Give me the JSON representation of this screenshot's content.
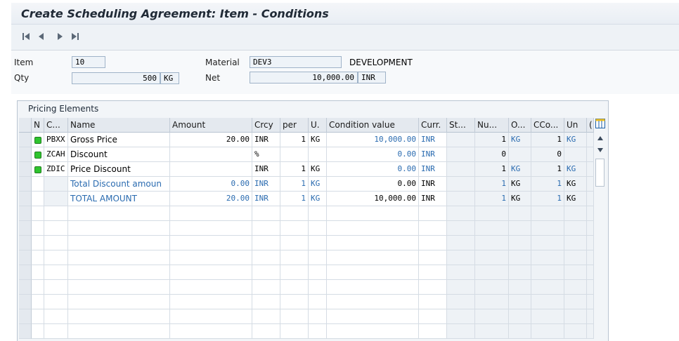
{
  "window": {
    "title": "Create Scheduling Agreement: Item - Conditions"
  },
  "toolbar": {
    "icons": [
      "first-page-icon",
      "previous-page-icon",
      "next-page-icon",
      "last-page-icon"
    ]
  },
  "header": {
    "item_label": "Item",
    "item_value": "10",
    "qty_label": "Qty",
    "qty_value": "500",
    "qty_unit": "KG",
    "material_label": "Material",
    "material_value": "DEV3",
    "material_desc": "DEVELOPMENT",
    "net_label": "Net",
    "net_value": "10,000.00",
    "net_currency": "INR"
  },
  "pricing": {
    "title": "Pricing Elements",
    "columns": [
      "N",
      "C...",
      "Name",
      "Amount",
      "Crcy",
      "per",
      "U.",
      "Condition value",
      "Curr.",
      "St...",
      "Nu...",
      "O...",
      "CCo...",
      "Un",
      "("
    ],
    "rows": [
      {
        "status": true,
        "ctype": "PBXX",
        "name": "Gross Price",
        "amount": "20.00",
        "crcy": "INR",
        "per": "1",
        "uom": "KG",
        "cond_value": "10,000.00",
        "curr": "INR",
        "st": "",
        "nu": "1",
        "o": "KG",
        "cco": "1",
        "un": "KG"
      },
      {
        "status": true,
        "ctype": "ZCAH",
        "name": "Discount",
        "amount": "",
        "crcy": "%",
        "per": "",
        "uom": "",
        "cond_value": "0.00",
        "curr": "INR",
        "st": "",
        "nu": "0",
        "o": "",
        "cco": "0",
        "un": ""
      },
      {
        "status": true,
        "ctype": "ZDIC",
        "name": "Price Discount",
        "amount": "",
        "crcy": "INR",
        "per": "1",
        "uom": "KG",
        "cond_value": "0.00",
        "curr": "INR",
        "st": "",
        "nu": "1",
        "o": "KG",
        "cco": "1",
        "un": "KG"
      },
      {
        "status": false,
        "ctype": "",
        "name": "Total Discount amoun",
        "amount": "0.00",
        "crcy": "INR",
        "per": "1",
        "uom": "KG",
        "cond_value": "0.00",
        "curr": "INR",
        "st": "",
        "nu": "1",
        "o": "KG",
        "cco": "1",
        "un": "KG"
      },
      {
        "status": false,
        "ctype": "",
        "name": "TOTAL AMOUNT",
        "amount": "20.00",
        "crcy": "INR",
        "per": "1",
        "uom": "KG",
        "cond_value": "10,000.00",
        "curr": "INR",
        "st": "",
        "nu": "1",
        "o": "KG",
        "cco": "1",
        "un": "KG"
      }
    ],
    "empty_rows": 9
  },
  "colors": {
    "accent_blue": "#2a6bb0",
    "status_green": "#2ec42e",
    "header_bg": "#e4e9ef"
  }
}
